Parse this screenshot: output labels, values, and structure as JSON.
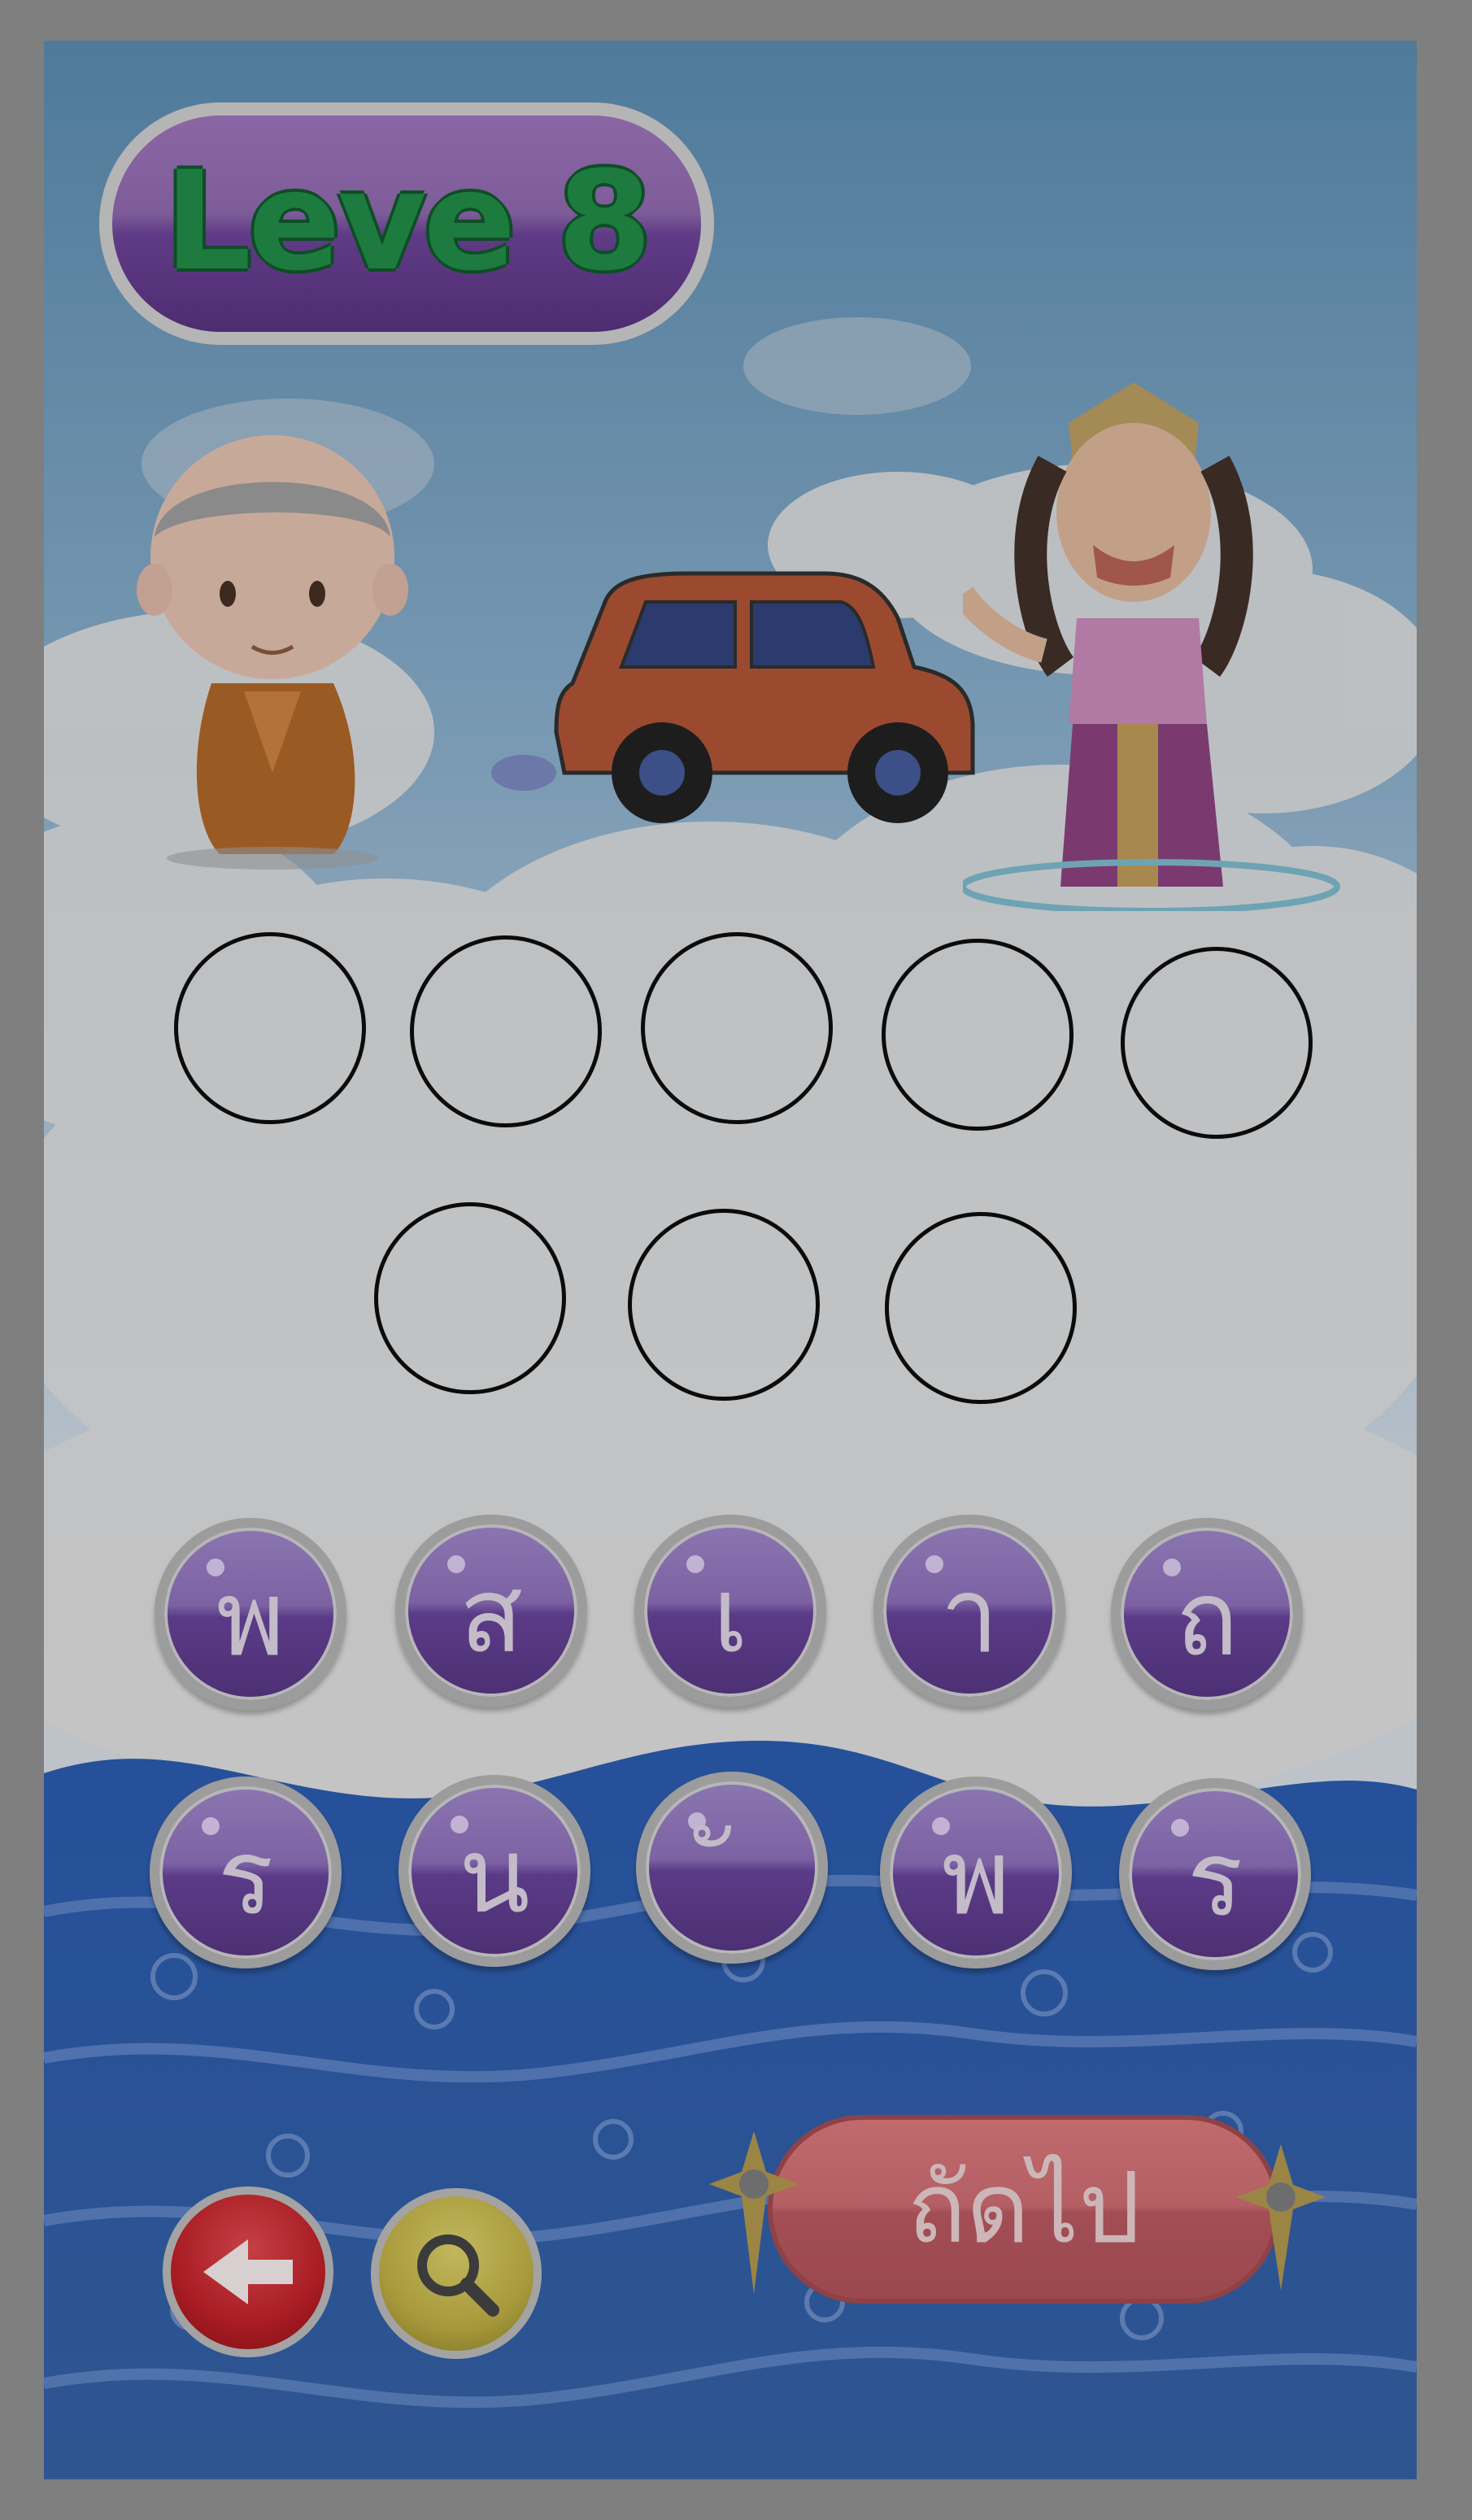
{
  "level": {
    "label": "Leve 8"
  },
  "answer_slots": {
    "row1_count": 5,
    "row2_count": 3
  },
  "letter_tiles": {
    "row1": [
      "พ",
      "ส",
      "เ",
      "า",
      "ถ"
    ],
    "row2": [
      "ร",
      "น",
      "ั",
      "พ",
      "ร"
    ]
  },
  "buttons": {
    "next_label": "ถัดไป",
    "back_icon": "arrow-left-icon",
    "hint_icon": "magnifier-icon"
  },
  "colors": {
    "tile_purple": "#6b4b94",
    "level_text_green": "#1d7b3f",
    "next_button_red": "#b45f63",
    "back_button_red": "#a81c22",
    "hint_button_gold": "#a89a3c"
  }
}
